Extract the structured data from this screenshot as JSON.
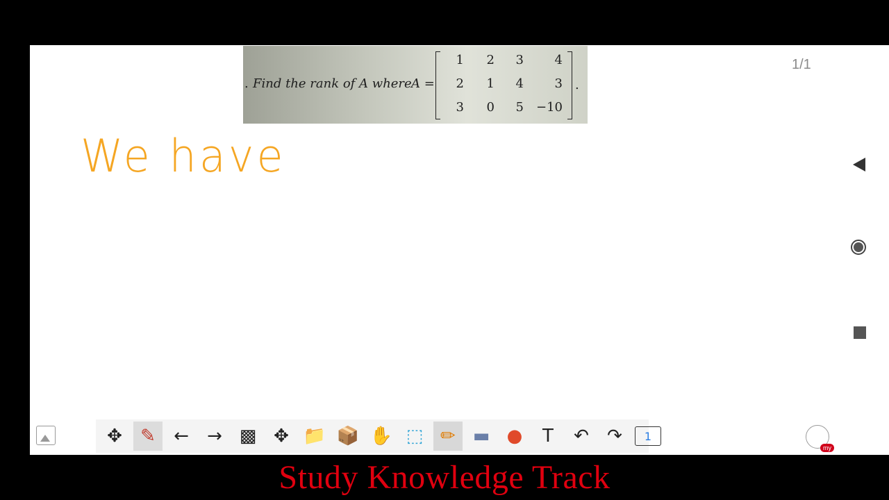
{
  "problem": {
    "prefix": ".",
    "statement": "Find the rank of A where",
    "matrix_label": "A =",
    "matrix": [
      [
        "1",
        "2",
        "3",
        "4"
      ],
      [
        "2",
        "1",
        "4",
        "3"
      ],
      [
        "3",
        "0",
        "5",
        "−10"
      ]
    ],
    "end_dot": "."
  },
  "page_indicator": "1/1",
  "handwriting": "We have",
  "handwriting_color": "#f5a623",
  "side_controls": [
    "collapse-arrow-icon",
    "record-icon",
    "stop-icon"
  ],
  "toolbar": {
    "tools": [
      {
        "name": "move-icon",
        "glyph": "✥"
      },
      {
        "name": "pen-settings-icon",
        "glyph": "✎"
      },
      {
        "name": "arrow-left-icon",
        "glyph": "←"
      },
      {
        "name": "arrow-right-icon",
        "glyph": "→"
      },
      {
        "name": "screenshot-icon",
        "glyph": "▩"
      },
      {
        "name": "pan-icon",
        "glyph": "✥"
      },
      {
        "name": "folder-icon",
        "glyph": "📁"
      },
      {
        "name": "box-icon",
        "glyph": "📦"
      },
      {
        "name": "hand-icon",
        "glyph": "✋"
      },
      {
        "name": "select-icon",
        "glyph": "⬚"
      },
      {
        "name": "marker-icon",
        "glyph": "✏"
      },
      {
        "name": "eraser-icon",
        "glyph": "▬"
      },
      {
        "name": "shapes-icon",
        "glyph": "●"
      },
      {
        "name": "text-icon",
        "glyph": "T"
      },
      {
        "name": "undo-icon",
        "glyph": "↶"
      },
      {
        "name": "redo-icon",
        "glyph": "↷"
      }
    ],
    "page_button": "1"
  },
  "profile_badge": "my",
  "banner": "Study Knowledge Track"
}
